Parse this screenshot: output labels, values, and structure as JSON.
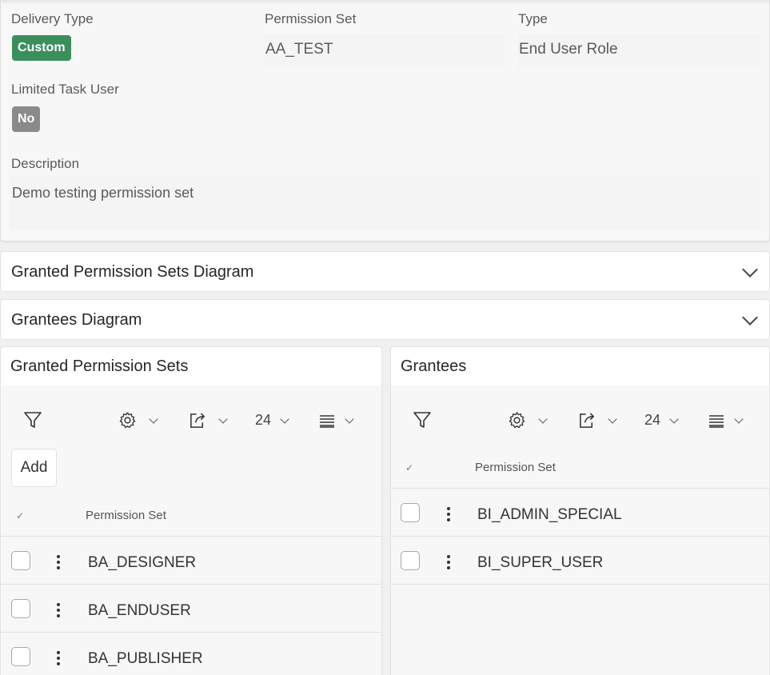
{
  "details": {
    "delivery_type": {
      "label": "Delivery Type",
      "value": "Custom",
      "color": "#3a8f5d"
    },
    "permission_set": {
      "label": "Permission Set",
      "value": "AA_TEST"
    },
    "type": {
      "label": "Type",
      "value": "End User Role"
    },
    "limited_task_user": {
      "label": "Limited Task User",
      "value": "No",
      "color": "#8a8a8a"
    },
    "description": {
      "label": "Description",
      "value": "Demo testing permission set"
    }
  },
  "regions": {
    "granted_diagram": {
      "title": "Granted Permission Sets Diagram",
      "icon": "chevron-down-icon"
    },
    "grantees_diagram": {
      "title": "Grantees Diagram",
      "icon": "chevron-down-icon"
    }
  },
  "granted_panel": {
    "title": "Granted Permission Sets",
    "toolbar": {
      "rows_per_page": "24",
      "add_label": "Add"
    },
    "column_header": "Permission Set",
    "rows": [
      "BA_DESIGNER",
      "BA_ENDUSER",
      "BA_PUBLISHER"
    ]
  },
  "grantees_panel": {
    "title": "Grantees",
    "toolbar": {
      "rows_per_page": "24"
    },
    "column_header": "Permission Set",
    "rows": [
      "BI_ADMIN_SPECIAL",
      "BI_SUPER_USER"
    ]
  },
  "icons": [
    "filter-icon",
    "gear-icon",
    "export-icon",
    "lines-icon",
    "chevron-down-icon",
    "kebab-icon",
    "check-icon"
  ]
}
